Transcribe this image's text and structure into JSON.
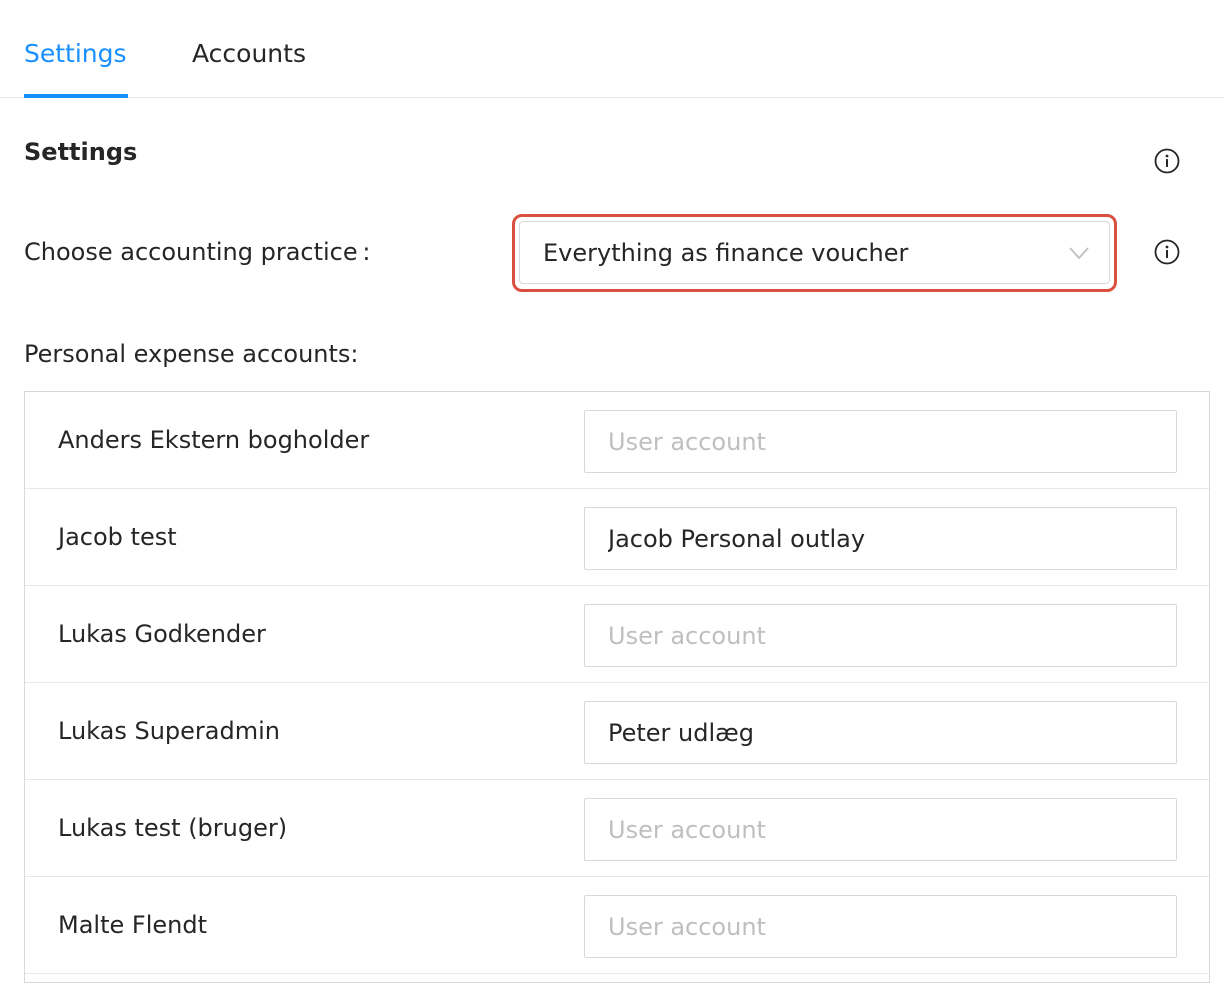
{
  "tabs": {
    "settings": "Settings",
    "accounts": "Accounts"
  },
  "section": {
    "title": "Settings"
  },
  "practice": {
    "label": "Choose accounting practice :",
    "selected": "Everything as finance voucher"
  },
  "personal_accounts": {
    "label": "Personal expense accounts:",
    "placeholder": "User account",
    "rows": [
      {
        "name": "Anders Ekstern bogholder",
        "value": ""
      },
      {
        "name": "Jacob test",
        "value": "Jacob Personal outlay"
      },
      {
        "name": "Lukas Godkender",
        "value": ""
      },
      {
        "name": "Lukas Superadmin",
        "value": "Peter udlæg"
      },
      {
        "name": "Lukas test (bruger)",
        "value": ""
      },
      {
        "name": "Malte Flendt",
        "value": ""
      }
    ]
  },
  "colors": {
    "accent": "#1890ff",
    "highlight": "#d9503f",
    "text": "#262626",
    "placeholder": "#bfbfbf",
    "border": "#d9d9d9"
  },
  "icons": {
    "info": "info-circle-icon",
    "dropdown": "chevron-down-icon"
  }
}
